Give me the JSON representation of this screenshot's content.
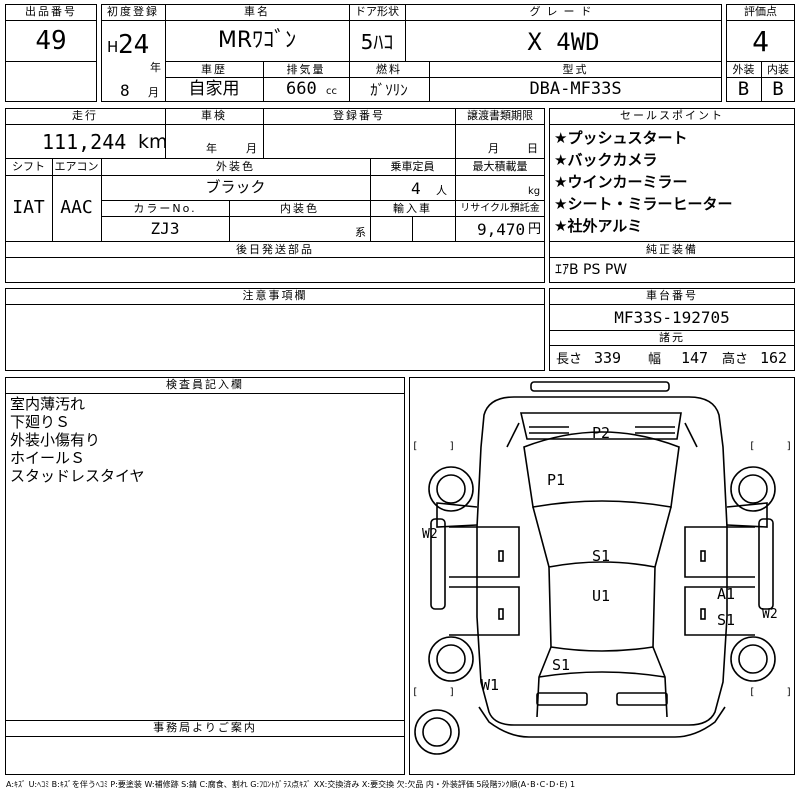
{
  "top": {
    "lot_no_label": "出品番号",
    "lot_no": "49",
    "first_reg_label": "初度登録",
    "era": "H",
    "year": "24",
    "year_unit": "年",
    "month": "8",
    "month_unit": "月",
    "car_name_label": "車名",
    "car_name": "MRﾜｺﾞﾝ",
    "door_label": "ドア形状",
    "door": "5ﾊｺ",
    "grade_label": "グレード",
    "grade": "X 4WD",
    "score_label": "評価点",
    "score": "4",
    "history_label": "車歴",
    "history": "自家用",
    "displacement_label": "排気量",
    "displacement": "660",
    "displacement_unit": "cc",
    "fuel_label": "燃料",
    "fuel": "ｶﾞｿﾘﾝ",
    "model_label": "型式",
    "model": "DBA-MF33S",
    "ext_label": "外装",
    "ext_grade": "B",
    "int_label": "内装",
    "int_grade": "B"
  },
  "mid": {
    "mileage_label": "走行",
    "mileage": "111,244",
    "mileage_unit": "km",
    "inspection_label": "車検",
    "insp_year_unit": "年",
    "insp_month_unit": "月",
    "reg_no_label": "登録番号",
    "transfer_label": "譲渡書類期限",
    "transfer_month_unit": "月",
    "transfer_day_unit": "日",
    "shift_label": "シフト",
    "shift": "IAT",
    "ac_label": "エアコン",
    "ac": "AAC",
    "ext_color_label": "外装色",
    "ext_color": "ブラック",
    "capacity_label": "乗車定員",
    "capacity": "4",
    "capacity_unit": "人",
    "max_load_label": "最大積載量",
    "max_load_unit": "kg",
    "color_no_label": "カラーNo.",
    "color_no": "ZJ3",
    "int_color_label": "内装色",
    "int_color_unit": "系",
    "import_label": "輸入車",
    "recycle_label": "リサイクル預託金",
    "recycle": "9,470",
    "recycle_unit": "円",
    "later_parts_label": "後日発送部品"
  },
  "sales": {
    "label": "セールスポイント",
    "items": [
      "★プッシュスタート",
      "★バックカメラ",
      "★ウインカーミラー",
      "★シート・ミラーヒーター",
      "★社外アルミ"
    ]
  },
  "equipment": {
    "label": "純正装備",
    "value": "ｴｱB PS PW"
  },
  "notes": {
    "label": "注意事項欄"
  },
  "chassis": {
    "label": "車台番号",
    "value": "MF33S-192705"
  },
  "dims": {
    "label": "諸元",
    "length_label": "長さ",
    "length": "339",
    "width_label": "幅",
    "width": "147",
    "height_label": "高さ",
    "height": "162"
  },
  "inspector": {
    "label": "検査員記入欄",
    "lines": [
      "室内薄汚れ",
      "下廻りＳ",
      "外装小傷有り",
      "ホイールＳ",
      "スタッドレスタイヤ"
    ]
  },
  "office": {
    "label": "事務局よりご案内"
  },
  "diagram": {
    "marks": {
      "p2": "P2",
      "p1": "P1",
      "s1_roof": "S1",
      "u1": "U1",
      "a1": "A1",
      "s1_side": "S1",
      "s1_rear": "S1",
      "w2_left": "W2",
      "w2_right": "W2",
      "w1": "W1"
    }
  },
  "legend": "A:ｷｽﾞ U:ﾍｺﾐ B:ｷｽﾞを伴うﾍｺﾐ P:要塗装 W:補修跡 S:錆 C:腐食、割れ G:ﾌﾛﾝﾄｶﾞﾗｽ点ｷｽﾞ XX:交換済み X:要交換 欠:欠品 内・外装評価 5段階ﾗﾝｸ順(A･B･C･D･E) 1"
}
